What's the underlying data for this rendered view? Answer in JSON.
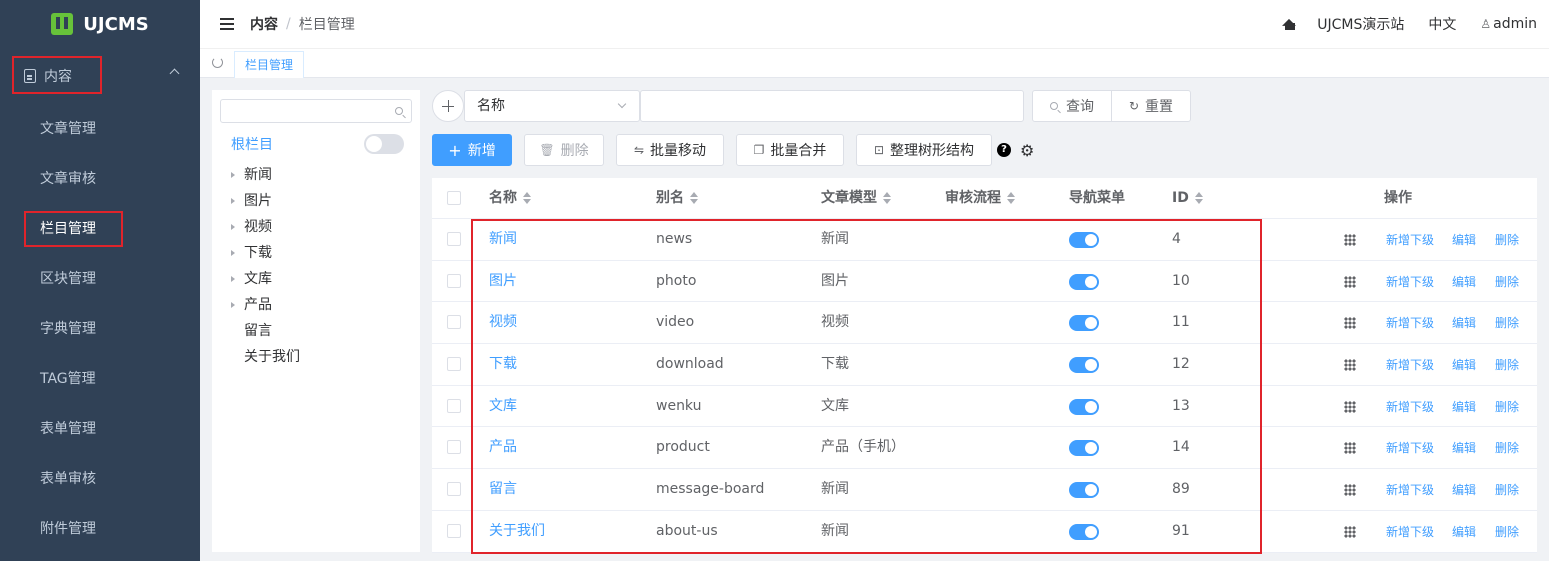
{
  "app": {
    "brand": "UJCMS",
    "brand_color": "#67c23a",
    "sidebar_bg": "#304156",
    "accent": "#409eff",
    "highlight_box_color": "#e0242b"
  },
  "sidebar": {
    "parent_label": "内容",
    "parent_icon": "document-icon",
    "items": [
      {
        "label": "文章管理"
      },
      {
        "label": "文章审核"
      },
      {
        "label": "栏目管理",
        "active": true
      },
      {
        "label": "区块管理"
      },
      {
        "label": "字典管理"
      },
      {
        "label": "TAG管理"
      },
      {
        "label": "表单管理"
      },
      {
        "label": "表单审核"
      },
      {
        "label": "附件管理"
      }
    ]
  },
  "header": {
    "breadcrumb": [
      "内容",
      "栏目管理"
    ],
    "separator": "/",
    "site_name": "UJCMS演示站",
    "language": "中文",
    "user": "admin"
  },
  "tabs": [
    {
      "label": "栏目管理"
    }
  ],
  "tree": {
    "search_placeholder": "",
    "root": "根栏目",
    "nodes": [
      {
        "label": "新闻",
        "has_children": true
      },
      {
        "label": "图片",
        "has_children": true
      },
      {
        "label": "视频",
        "has_children": true
      },
      {
        "label": "下载",
        "has_children": true
      },
      {
        "label": "文库",
        "has_children": true
      },
      {
        "label": "产品",
        "has_children": true
      },
      {
        "label": "留言",
        "has_children": false
      },
      {
        "label": "关于我们",
        "has_children": false
      }
    ]
  },
  "search": {
    "field_selected": "名称",
    "query_value": "",
    "query_button": "查询",
    "reset_button": "重置"
  },
  "actions": {
    "add": "新增",
    "delete": "删除",
    "batch_move": "批量移动",
    "batch_merge": "批量合并",
    "tidy_tree": "整理树形结构",
    "help": "?"
  },
  "table": {
    "columns": {
      "name": "名称",
      "alias": "别名",
      "model": "文章模型",
      "workflow": "审核流程",
      "nav": "导航菜单",
      "id": "ID",
      "ops": "操作"
    },
    "row_ops": {
      "add_child": "新增下级",
      "edit": "编辑",
      "delete": "删除"
    },
    "rows": [
      {
        "name": "新闻",
        "alias": "news",
        "model": "新闻",
        "workflow": "",
        "nav": true,
        "id": "4"
      },
      {
        "name": "图片",
        "alias": "photo",
        "model": "图片",
        "workflow": "",
        "nav": true,
        "id": "10"
      },
      {
        "name": "视频",
        "alias": "video",
        "model": "视频",
        "workflow": "",
        "nav": true,
        "id": "11"
      },
      {
        "name": "下载",
        "alias": "download",
        "model": "下载",
        "workflow": "",
        "nav": true,
        "id": "12"
      },
      {
        "name": "文库",
        "alias": "wenku",
        "model": "文库",
        "workflow": "",
        "nav": true,
        "id": "13"
      },
      {
        "name": "产品",
        "alias": "product",
        "model": "产品（手机）",
        "workflow": "",
        "nav": true,
        "id": "14"
      },
      {
        "name": "留言",
        "alias": "message-board",
        "model": "新闻",
        "workflow": "",
        "nav": true,
        "id": "89"
      },
      {
        "name": "关于我们",
        "alias": "about-us",
        "model": "新闻",
        "workflow": "",
        "nav": true,
        "id": "91"
      }
    ]
  }
}
